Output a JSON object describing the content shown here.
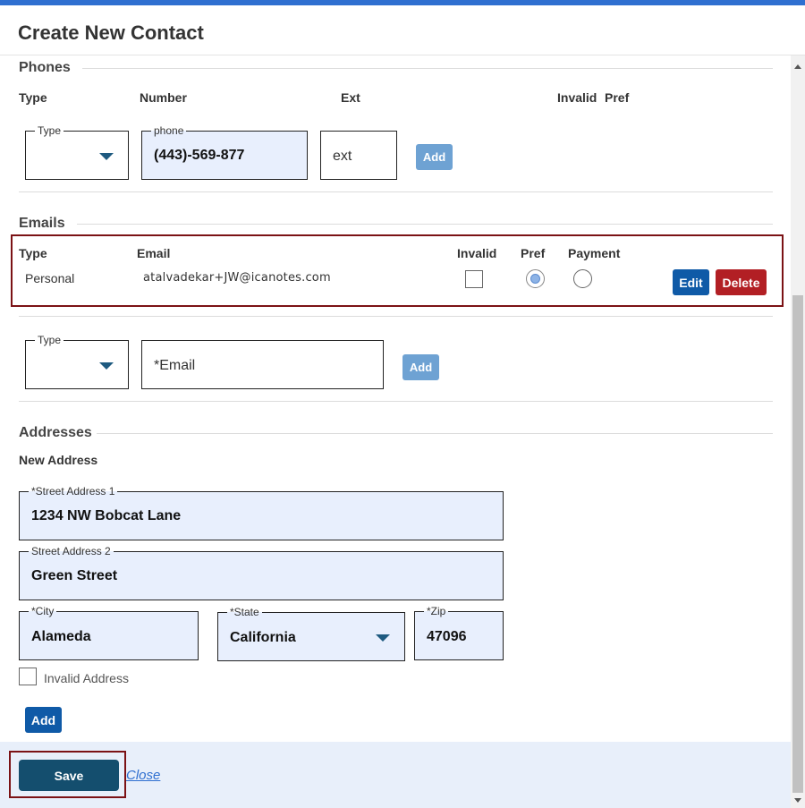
{
  "dialog": {
    "title": "Create New Contact"
  },
  "phones": {
    "section_title": "Phones",
    "headers": {
      "type": "Type",
      "number": "Number",
      "ext": "Ext",
      "invalid": "Invalid",
      "pref": "Pref"
    },
    "type_legend": "Type",
    "type_value": "",
    "phone_legend": "phone",
    "phone_value": "(443)-569-877",
    "ext_placeholder": "ext",
    "add_label": "Add"
  },
  "emails": {
    "section_title": "Emails",
    "headers": {
      "type": "Type",
      "email": "Email",
      "invalid": "Invalid",
      "pref": "Pref",
      "payment": "Payment"
    },
    "rows": [
      {
        "type": "Personal",
        "email": "atalvadekar+JW@icanotes.com",
        "invalid": false,
        "pref": true,
        "payment": false
      }
    ],
    "edit_label": "Edit",
    "delete_label": "Delete",
    "type_legend": "Type",
    "email_placeholder": "*Email",
    "add_label": "Add"
  },
  "addresses": {
    "section_title": "Addresses",
    "subtitle": "New Address",
    "street1_legend": "*Street Address 1",
    "street1_value": "1234 NW Bobcat Lane",
    "street2_legend": "Street Address 2",
    "street2_value": "Green Street",
    "city_legend": "*City",
    "city_value": "Alameda",
    "state_legend": "*State",
    "state_value": "California",
    "zip_legend": "*Zip",
    "zip_value": "47096",
    "invalid_label": "Invalid Address",
    "invalid_checked": false,
    "add_label": "Add"
  },
  "footer": {
    "save_label": "Save",
    "close_label": "Close"
  },
  "colors": {
    "accent": "#2f6fd0",
    "primary_button": "#0f5aa7",
    "delete_button": "#b21f24",
    "save_button": "#144e6e",
    "highlight": "#7b1215"
  }
}
